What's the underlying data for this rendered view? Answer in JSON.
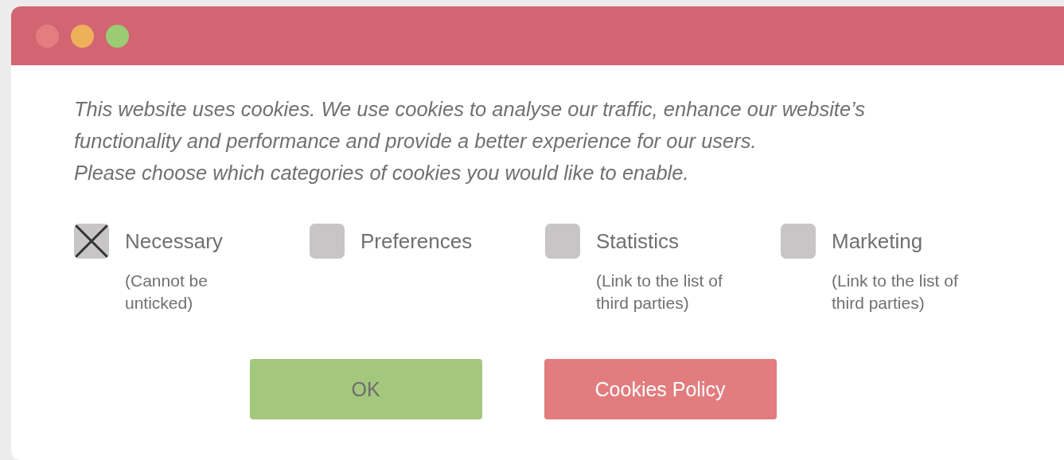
{
  "message": {
    "lines": [
      "This website uses cookies. We use cookies to analyse our traffic, enhance our website’s",
      "functionality and performance and provide a better experience for our users.",
      "Please choose which categories of cookies you would like to enable."
    ]
  },
  "categories": [
    {
      "label": "Necessary",
      "checked": true,
      "note": "(Cannot be unticked)"
    },
    {
      "label": "Preferences",
      "checked": false
    },
    {
      "label": "Statistics",
      "checked": false,
      "note": "(Link to the list of third parties)"
    },
    {
      "label": "Marketing",
      "checked": false,
      "note": "(Link to the list of third parties)"
    }
  ],
  "buttons": [
    {
      "label": "OK",
      "kind": "accept"
    },
    {
      "label": "Cookies Policy",
      "kind": "policy"
    }
  ]
}
